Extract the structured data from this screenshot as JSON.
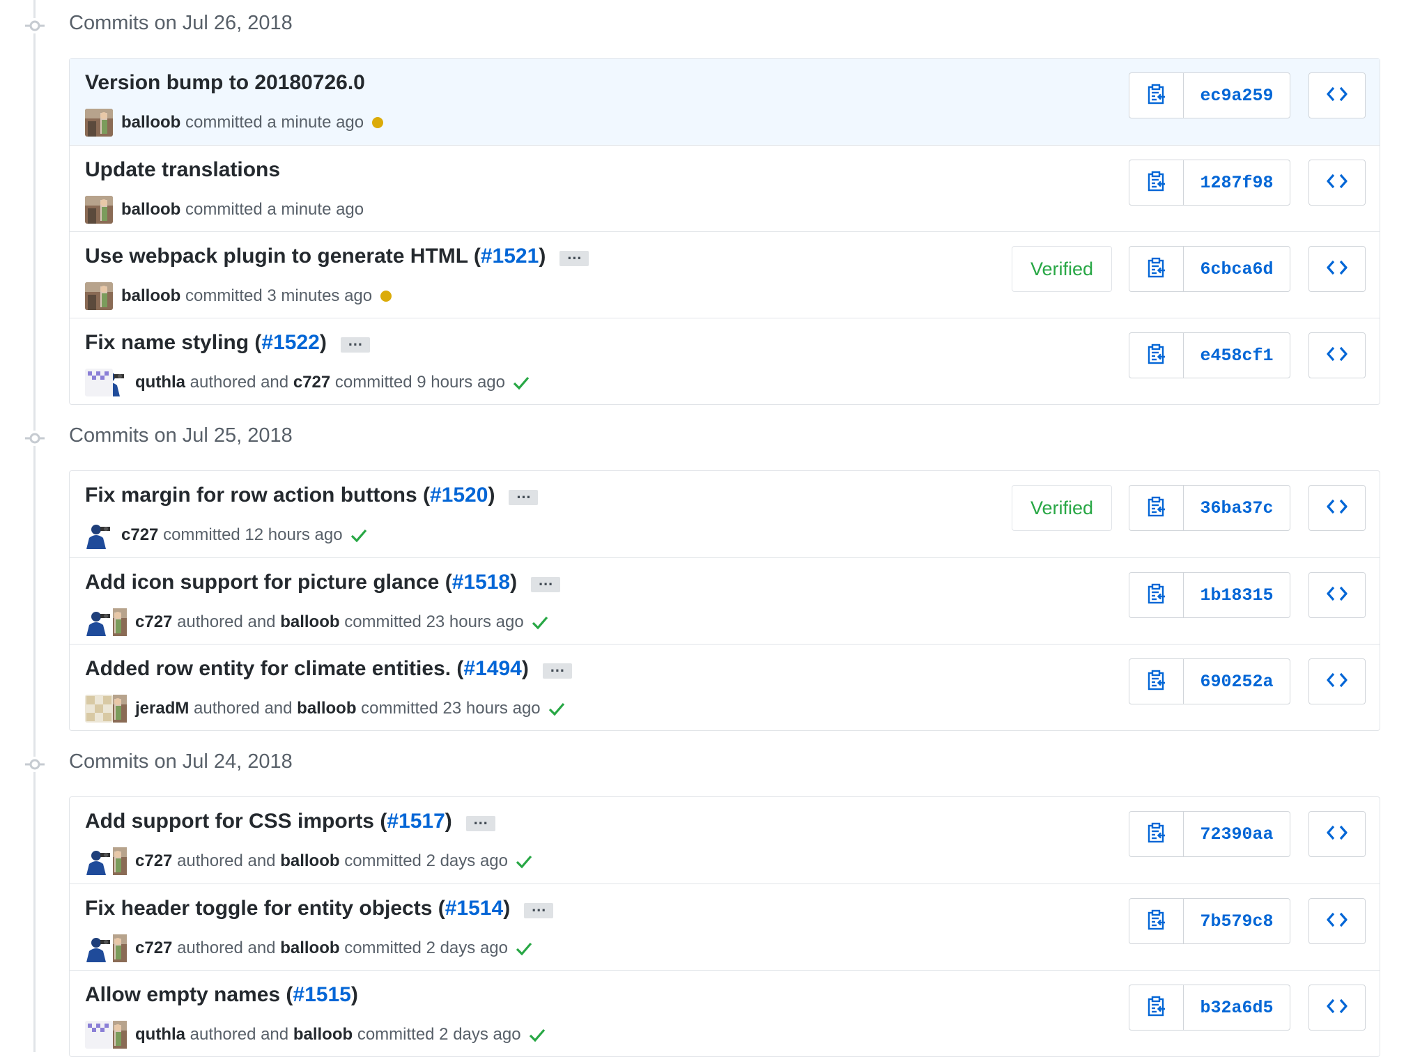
{
  "groups": [
    {
      "heading": "Commits on Jul 26, 2018",
      "commits": [
        {
          "title": "Version bump to 20180726.0",
          "pr": "",
          "has_ellipsis": false,
          "author": "balloob",
          "author_avatar": "balloob",
          "committer": "",
          "committer_avatar": "",
          "action1": "committed a minute ago",
          "action2": "",
          "status": "pending",
          "verified": "",
          "sha": "ec9a259",
          "highlight": true
        },
        {
          "title": "Update translations",
          "pr": "",
          "has_ellipsis": false,
          "author": "balloob",
          "author_avatar": "balloob",
          "committer": "",
          "committer_avatar": "",
          "action1": "committed a minute ago",
          "action2": "",
          "status": "none",
          "verified": "",
          "sha": "1287f98",
          "highlight": false
        },
        {
          "title": "Use webpack plugin to generate HTML (",
          "pr": "#1521",
          "has_ellipsis": true,
          "author": "balloob",
          "author_avatar": "balloob",
          "committer": "",
          "committer_avatar": "",
          "action1": "committed 3 minutes ago",
          "action2": "",
          "status": "pending",
          "verified": "Verified",
          "sha": "6cbca6d",
          "highlight": false
        },
        {
          "title": "Fix name styling (",
          "pr": "#1522",
          "has_ellipsis": true,
          "author": "quthla",
          "author_avatar": "quthla",
          "committer": "c727",
          "committer_avatar": "c727",
          "action1": "authored and",
          "action2": "committed 9 hours ago",
          "status": "success",
          "verified": "",
          "sha": "e458cf1",
          "highlight": false
        }
      ]
    },
    {
      "heading": "Commits on Jul 25, 2018",
      "commits": [
        {
          "title": "Fix margin for row action buttons (",
          "pr": "#1520",
          "has_ellipsis": true,
          "author": "c727",
          "author_avatar": "c727",
          "committer": "",
          "committer_avatar": "",
          "action1": "committed 12 hours ago",
          "action2": "",
          "status": "success",
          "verified": "Verified",
          "sha": "36ba37c",
          "highlight": false
        },
        {
          "title": "Add icon support for picture glance (",
          "pr": "#1518",
          "has_ellipsis": true,
          "author": "c727",
          "author_avatar": "c727",
          "committer": "balloob",
          "committer_avatar": "balloob",
          "action1": "authored and",
          "action2": "committed 23 hours ago",
          "status": "success",
          "verified": "",
          "sha": "1b18315",
          "highlight": false
        },
        {
          "title": "Added row entity for climate entities. (",
          "pr": "#1494",
          "has_ellipsis": true,
          "author": "jeradM",
          "author_avatar": "jeradM",
          "committer": "balloob",
          "committer_avatar": "balloob",
          "action1": "authored and",
          "action2": "committed 23 hours ago",
          "status": "success",
          "verified": "",
          "sha": "690252a",
          "highlight": false
        }
      ]
    },
    {
      "heading": "Commits on Jul 24, 2018",
      "commits": [
        {
          "title": "Add support for CSS imports (",
          "pr": "#1517",
          "has_ellipsis": true,
          "author": "c727",
          "author_avatar": "c727",
          "committer": "balloob",
          "committer_avatar": "balloob",
          "action1": "authored and",
          "action2": "committed 2 days ago",
          "status": "success",
          "verified": "",
          "sha": "72390aa",
          "highlight": false
        },
        {
          "title": "Fix header toggle for entity objects (",
          "pr": "#1514",
          "has_ellipsis": true,
          "author": "c727",
          "author_avatar": "c727",
          "committer": "balloob",
          "committer_avatar": "balloob",
          "action1": "authored and",
          "action2": "committed 2 days ago",
          "status": "success",
          "verified": "",
          "sha": "7b579c8",
          "highlight": false
        },
        {
          "title": "Allow empty names (",
          "pr": "#1515",
          "has_ellipsis": false,
          "author": "quthla",
          "author_avatar": "quthla",
          "committer": "balloob",
          "committer_avatar": "balloob",
          "action1": "authored and",
          "action2": "committed 2 days ago",
          "status": "success",
          "verified": "",
          "sha": "b32a6d5",
          "highlight": false
        }
      ]
    }
  ],
  "icons": {
    "timeline": "git-commit-icon",
    "copy": "clipboard-icon",
    "browse": "code-icon",
    "ellipsis": "ellipsis-icon",
    "pending": "pending-dot-icon",
    "success": "check-icon"
  },
  "colors": {
    "link": "#0366d6",
    "pending": "#dbab09",
    "success": "#28a745",
    "highlight_row": "#f1f8ff"
  }
}
